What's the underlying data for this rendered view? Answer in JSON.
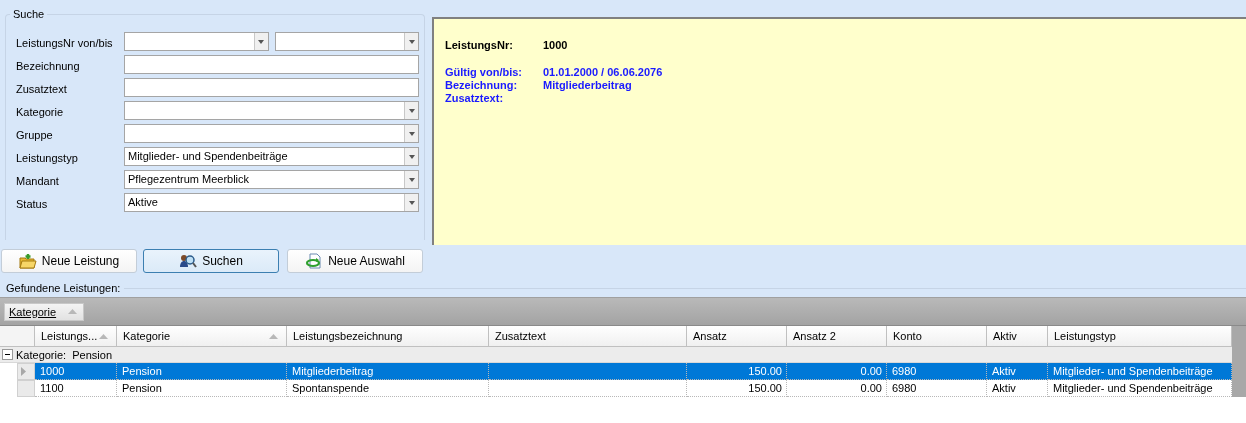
{
  "search": {
    "title": "Suche",
    "fields": [
      {
        "label": "LeistungsNr von/bis",
        "kind": "combo-pair"
      },
      {
        "label": "Bezeichnung",
        "kind": "text"
      },
      {
        "label": "Zusatztext",
        "kind": "text"
      },
      {
        "label": "Kategorie",
        "kind": "combo"
      },
      {
        "label": "Gruppe",
        "kind": "combo"
      },
      {
        "label": "Leistungstyp",
        "kind": "combo",
        "value": "Mitglieder- und Spendenbeiträge"
      },
      {
        "label": "Mandant",
        "kind": "combo",
        "value": "Pflegezentrum Meerblick"
      },
      {
        "label": "Status",
        "kind": "combo",
        "value": "Aktive"
      }
    ]
  },
  "detail": {
    "lines": [
      {
        "kind": "header",
        "label": "LeistungsNr:",
        "value": "1000"
      },
      {
        "kind": "info",
        "label": "Gültig von/bis:",
        "value": "01.01.2000 / 06.06.2076"
      },
      {
        "kind": "info",
        "label": "Bezeichnung:",
        "value": "Mitgliederbeitrag"
      },
      {
        "kind": "info",
        "label": "Zusatztext:"
      }
    ]
  },
  "buttons": [
    {
      "label": "Neue Leistung",
      "kind": "folder",
      "focused": false
    },
    {
      "label": "Suchen",
      "kind": "search",
      "focused": true
    },
    {
      "label": "Neue Auswahl",
      "kind": "refresh",
      "focused": false
    }
  ],
  "results": {
    "title": "Gefundene Leistungen:",
    "group_by": {
      "label": "Kategorie",
      "sorted": true
    },
    "columns": [
      {
        "label": "Leistungs...",
        "sorted": true,
        "kind": "text"
      },
      {
        "label": "Kategorie",
        "sorted": true,
        "kind": "text"
      },
      {
        "label": "Leistungsbezeichnung",
        "sorted": false,
        "kind": "text"
      },
      {
        "label": "Zusatztext",
        "sorted": false,
        "kind": "text"
      },
      {
        "label": "Ansatz",
        "sorted": false,
        "kind": "number"
      },
      {
        "label": "Ansatz 2",
        "sorted": false,
        "kind": "number"
      },
      {
        "label": "Konto",
        "sorted": false,
        "kind": "text"
      },
      {
        "label": "Aktiv",
        "sorted": false,
        "kind": "text"
      },
      {
        "label": "Leistungstyp",
        "sorted": false,
        "kind": "text"
      }
    ],
    "groups": [
      {
        "label": "Kategorie:  Pension",
        "expanded": true,
        "rows": [
          {
            "selected": true,
            "cells": [
              "1000",
              "Pension",
              "Mitgliederbeitrag",
              "",
              "150.00",
              "0.00",
              "6980",
              "Aktiv",
              "Mitglieder- und Spendenbeiträge"
            ]
          },
          {
            "selected": false,
            "cells": [
              "1100",
              "Pension",
              "Spontanspende",
              "",
              "150.00",
              "0.00",
              "6980",
              "Aktiv",
              "Mitglieder- und Spendenbeiträge"
            ]
          }
        ]
      }
    ]
  }
}
